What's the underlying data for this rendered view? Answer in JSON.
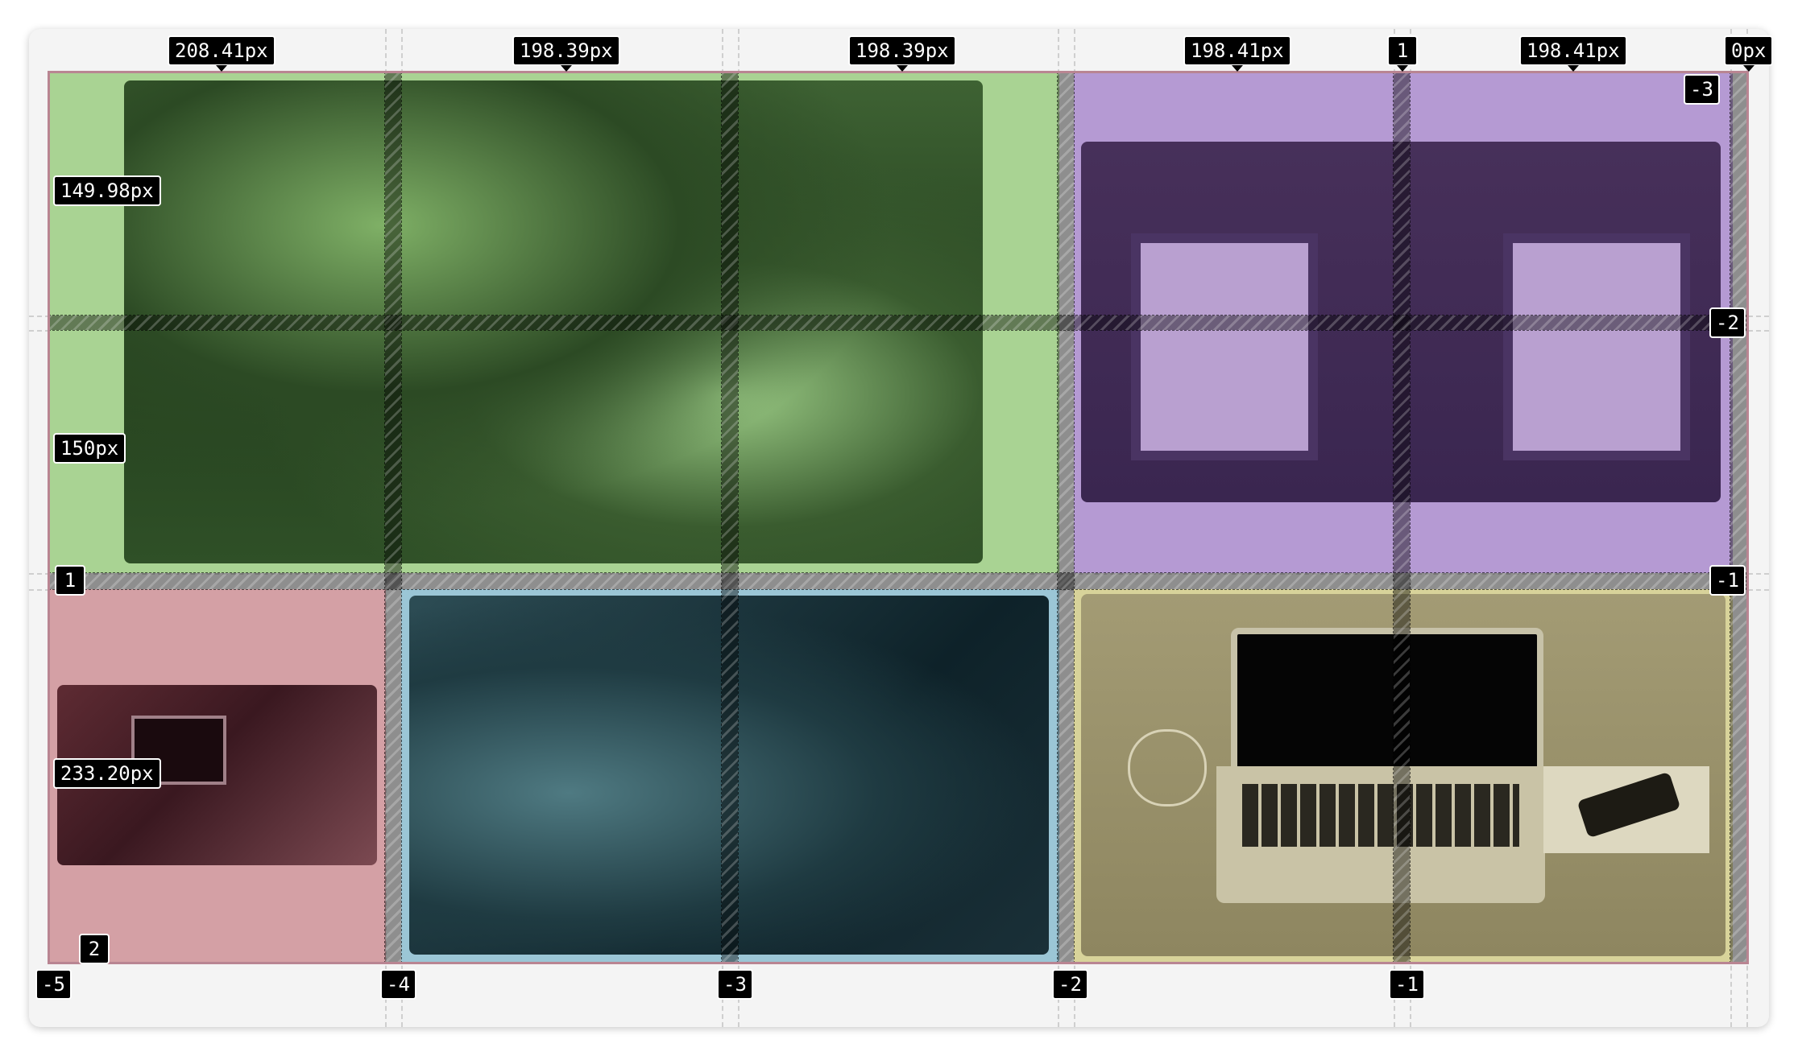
{
  "column_sizes": [
    "208.41px",
    "198.39px",
    "198.39px",
    "198.41px",
    "198.41px",
    "0px"
  ],
  "row_sizes": [
    "149.98px",
    "150px",
    "233.20px"
  ],
  "top_line_number": "1",
  "top_right_line_number": "-3",
  "right_line_numbers": [
    "-2",
    "-1"
  ],
  "left_line_number": "1",
  "bottom_left_row_line": "2",
  "bottom_line_numbers": [
    "-5",
    "-4",
    "-3",
    "-2",
    "-1"
  ],
  "areas": {
    "green": {
      "overlay": "#a9d393",
      "photo": "tree-leaves-photo"
    },
    "purple": {
      "overlay": "#b59ad3",
      "photo": "ivy-windows-photo"
    },
    "pink": {
      "overlay": "#d4a0a5",
      "photo": "person-laptop-photo"
    },
    "blue": {
      "overlay": "#9bc6d6",
      "photo": "rock-surface-photo"
    },
    "yellow": {
      "overlay": "#d8d39a",
      "photo": "desk-laptop-photo"
    }
  }
}
